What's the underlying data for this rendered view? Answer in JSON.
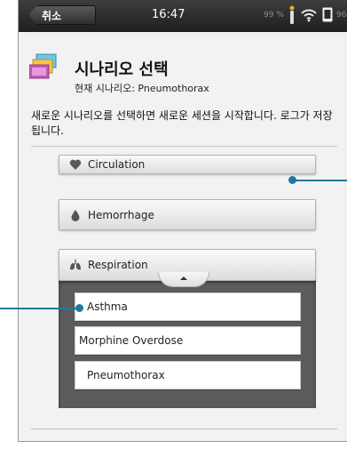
{
  "statusbar": {
    "back_label": "취소",
    "time": "16:47",
    "battery_primary": "99 %",
    "battery_secondary": "96 %"
  },
  "header": {
    "title": "시나리오 선택",
    "subtitle": "현재 시나리오: Pneumothorax",
    "icon": "scenario-cards-icon"
  },
  "description": "새로운 시나리오를 선택하면 새로운 세션을 시작합니다. 로그가 저장됩니다.",
  "categories": [
    {
      "label": "Circulation",
      "icon": "heart-icon"
    },
    {
      "label": "Hemorrhage",
      "icon": "drop-icon"
    },
    {
      "label": "Respiration",
      "icon": "lungs-icon"
    }
  ],
  "respiration_items": [
    "Asthma",
    "Morphine Overdose",
    "Pneumothorax"
  ],
  "colors": {
    "callout": "#1e7a9c",
    "statusbar": "#2a2a2a",
    "panel": "#5c5c5c"
  }
}
